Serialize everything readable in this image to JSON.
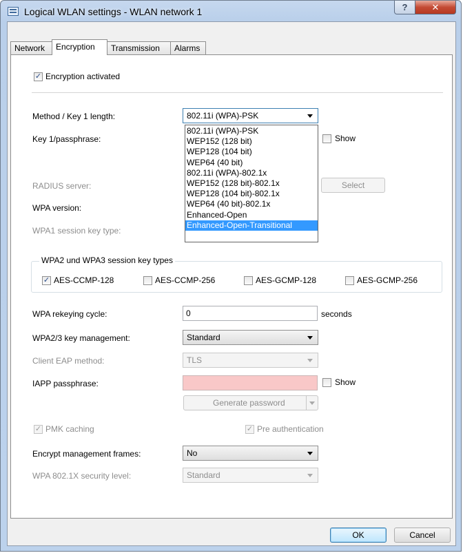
{
  "window": {
    "title": "Logical WLAN settings - WLAN network 1",
    "help_label": "?",
    "close_label": "✕"
  },
  "tabs": [
    {
      "label": "Network"
    },
    {
      "label": "Encryption"
    },
    {
      "label": "Transmission"
    },
    {
      "label": "Alarms"
    }
  ],
  "encryption_activated": {
    "label": "Encryption activated",
    "checked": true
  },
  "method": {
    "label": "Method / Key 1 length:",
    "value": "802.11i (WPA)-PSK"
  },
  "method_options": [
    "802.11i (WPA)-PSK",
    "WEP152 (128 bit)",
    "WEP128 (104 bit)",
    "WEP64 (40 bit)",
    "802.11i (WPA)-802.1x",
    "WEP152 (128 bit)-802.1x",
    "WEP128 (104 bit)-802.1x",
    "WEP64 (40 bit)-802.1x",
    "Enhanced-Open",
    "Enhanced-Open-Transitional"
  ],
  "key_passphrase": {
    "label": "Key 1/passphrase:",
    "show_label": "Show"
  },
  "radius_server": {
    "label": "RADIUS server:",
    "select_label": "Select"
  },
  "wpa_version": {
    "label": "WPA version:"
  },
  "wpa1_session_key_type": {
    "label": "WPA1 session key type:"
  },
  "session_key_types": {
    "title": "WPA2 und WPA3 session key types",
    "aes_ccmp_128": "AES-CCMP-128",
    "aes_ccmp_256": "AES-CCMP-256",
    "aes_gcmp_128": "AES-GCMP-128",
    "aes_gcmp_256": "AES-GCMP-256"
  },
  "rekeying": {
    "label": "WPA rekeying cycle:",
    "value": "0",
    "unit": "seconds"
  },
  "key_management": {
    "label": "WPA2/3 key management:",
    "value": "Standard"
  },
  "client_eap": {
    "label": "Client EAP method:",
    "value": "TLS"
  },
  "iapp": {
    "label": "IAPP passphrase:",
    "show_label": "Show",
    "generate_label": "Generate password"
  },
  "pmk_caching": {
    "label": "PMK caching"
  },
  "pre_authentication": {
    "label": "Pre authentication"
  },
  "management_frames": {
    "label": "Encrypt management frames:",
    "value": "No"
  },
  "security_level": {
    "label": "WPA 802.1X security level:",
    "value": "Standard"
  },
  "buttons": {
    "ok": "OK",
    "cancel": "Cancel"
  },
  "colors": {
    "selection": "#3399ff",
    "invalid_field": "#f9c8c8",
    "frame": "#b9cfea"
  }
}
